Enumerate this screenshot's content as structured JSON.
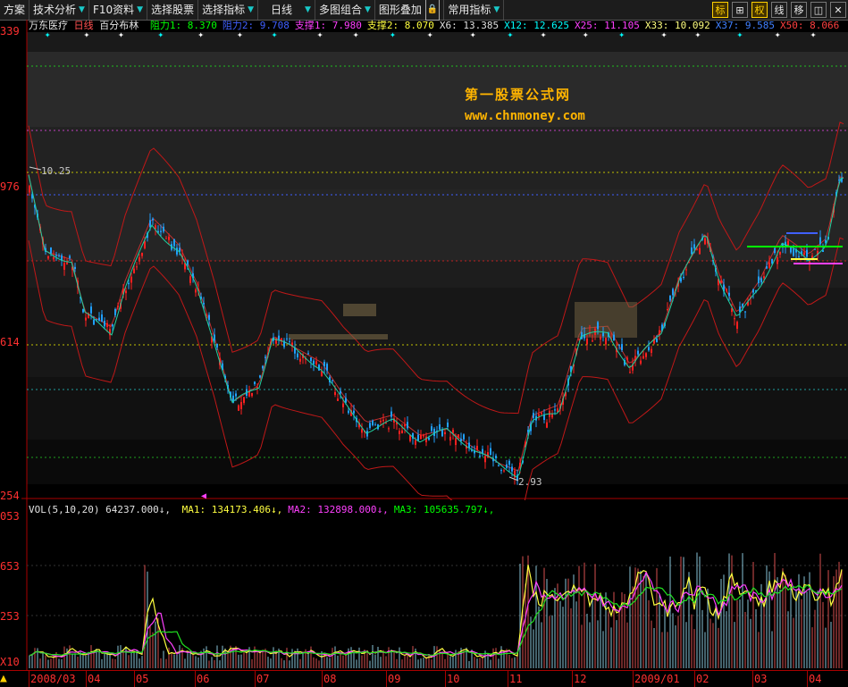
{
  "toolbar": {
    "items": [
      {
        "label": "方案",
        "arrow": false
      },
      {
        "label": "技术分析",
        "arrow": true
      },
      {
        "label": "F10资料",
        "arrow": true
      },
      {
        "label": "选择股票",
        "arrow": false
      },
      {
        "label": "选择指标",
        "arrow": true
      },
      {
        "label": "日线",
        "arrow": true
      },
      {
        "label": "多图组合",
        "arrow": true
      },
      {
        "label": "图形叠加",
        "arrow": false
      },
      {
        "label": "常用指标",
        "arrow": true
      }
    ],
    "right": [
      {
        "label": "标",
        "active": true
      },
      {
        "label": "⊞",
        "active": false
      },
      {
        "label": "权",
        "active": true
      },
      {
        "label": "线",
        "active": false
      },
      {
        "label": "移",
        "active": false
      },
      {
        "label": "◫",
        "active": false
      },
      {
        "label": "✕",
        "active": false
      }
    ],
    "lock_icon": "lock-icon"
  },
  "stock": {
    "name": "万东医疗",
    "period": "日线",
    "indicator": "百分布林"
  },
  "legend": [
    {
      "label": "阻力1",
      "value": "8.370",
      "color": "#00ff00"
    },
    {
      "label": "阻力2",
      "value": "9.708",
      "color": "#4060ff"
    },
    {
      "label": "支撑1",
      "value": "7.980",
      "color": "#ff40ff"
    },
    {
      "label": "支撑2",
      "value": "8.070",
      "color": "#ffff40"
    },
    {
      "label": "X6",
      "value": "13.385",
      "color": "#e0e0e0"
    },
    {
      "label": "X12",
      "value": "12.625",
      "color": "#00ffff"
    },
    {
      "label": "X25",
      "value": "11.105",
      "color": "#ff40ff"
    },
    {
      "label": "X33",
      "value": "10.092",
      "color": "#ffff80"
    },
    {
      "label": "X37",
      "value": "9.585",
      "color": "#4080ff"
    },
    {
      "label": "X50",
      "value": "8.066",
      "color": "#ff4040"
    }
  ],
  "y_labels": [
    "339",
    "976",
    "614",
    "254"
  ],
  "price_labels": {
    "high": "10.25",
    "low": "2.93"
  },
  "watermark": {
    "line1": "第一股票公式网",
    "line2": "www.chnmoney.com"
  },
  "volume": {
    "title": "VOL(5,10,20)",
    "value": "64237.000",
    "ma": [
      {
        "label": "MA1",
        "value": "134173.406",
        "color": "#ffff40"
      },
      {
        "label": "MA2",
        "value": "132898.000",
        "color": "#ff40ff"
      },
      {
        "label": "MA3",
        "value": "105635.797",
        "color": "#00ff00"
      }
    ],
    "y_labels": [
      "053",
      "653",
      "253"
    ],
    "unit": "X10"
  },
  "x_axis": [
    "2008/03",
    "04",
    "05",
    "06",
    "07",
    "08",
    "09",
    "10",
    "11",
    "12",
    "2009/01",
    "02",
    "03",
    "04"
  ],
  "chart_data": {
    "type": "candlestick",
    "price_range": [
      2.93,
      10.25
    ],
    "high": 10.25,
    "low": 2.93,
    "volume_ma": {
      "MA1": 134173.406,
      "MA2": 132898.0,
      "MA3": 105635.797
    },
    "last_volume": 64237.0,
    "levels": {
      "阻力1": 8.37,
      "阻力2": 9.708,
      "支撑1": 7.98,
      "支撑2": 8.07
    },
    "ma": {
      "X6": 13.385,
      "X12": 12.625,
      "X25": 11.105,
      "X33": 10.092,
      "X37": 9.585,
      "X50": 8.066
    }
  }
}
